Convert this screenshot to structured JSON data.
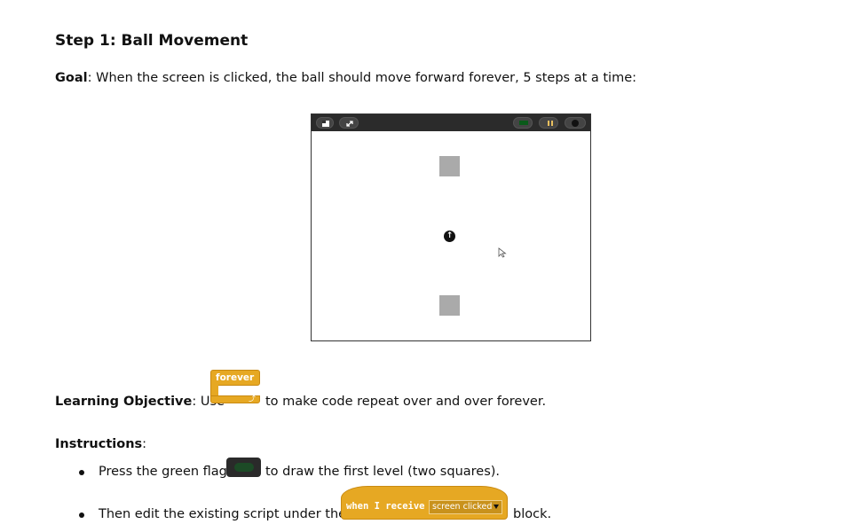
{
  "heading": "Step 1: Ball Movement",
  "goal": {
    "label": "Goal",
    "text": ": When the screen is clicked, the ball should move forward forever, 5 steps at a time:"
  },
  "stage": {
    "ball_glyph": "↑",
    "colors": {
      "bar": "#2b2b2b",
      "square": "#aaaaaa",
      "ball": "#111111"
    }
  },
  "objective": {
    "label": "Learning Objective",
    "pre": ": Use",
    "post": "to make code repeat over and over forever.",
    "block_label": "forever",
    "loop_glyph": "⤴"
  },
  "instructions": {
    "label": "Instructions",
    "colon": ":",
    "item1": {
      "pre": "Press the green flag",
      "post": "to draw the first level (two squares)."
    },
    "item2": {
      "pre": "Then edit the existing script under the",
      "post": "block.",
      "hat_label": "when I receive",
      "hat_value": "screen clicked"
    }
  },
  "accent": {
    "block_orange": "#e6a823"
  }
}
